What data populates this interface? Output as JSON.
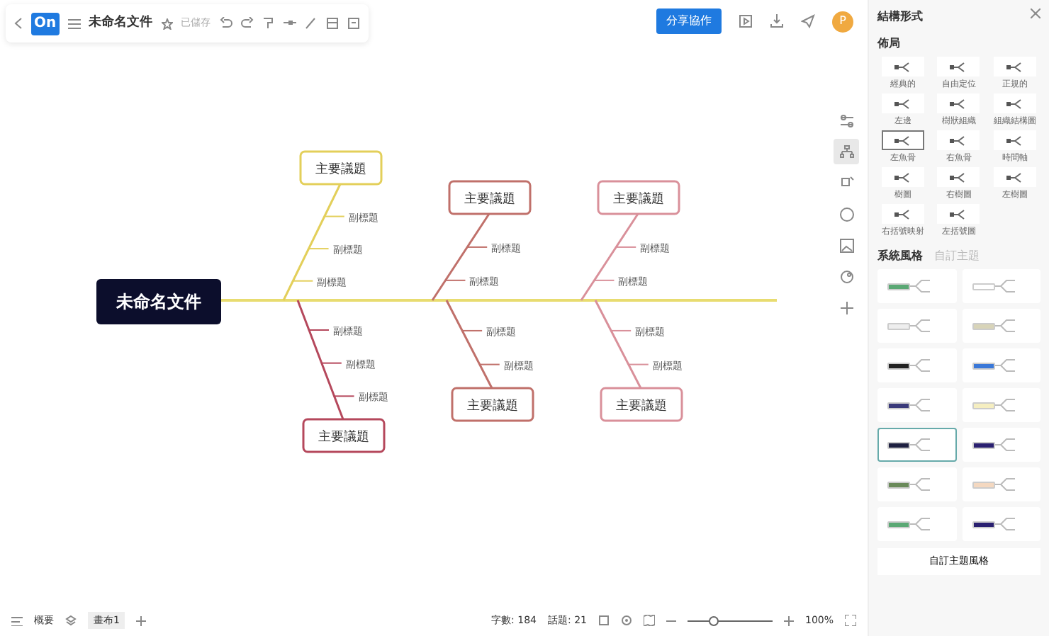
{
  "toolbar": {
    "logo": "On",
    "title": "未命名文件",
    "save_status": "已儲存",
    "share_button": "分享協作",
    "avatar": "P"
  },
  "canvas": {
    "central_topic": "未命名文件",
    "main_topics": [
      {
        "label": "主要議題",
        "kind": "top",
        "color": "#e3cf5a",
        "subtopics": [
          "副標題",
          "副標題",
          "副標題"
        ]
      },
      {
        "label": "主要議題",
        "kind": "bottom",
        "color": "#b5485c",
        "subtopics": [
          "副標題",
          "副標題",
          "副標題"
        ]
      },
      {
        "label": "主要議題",
        "kind": "top",
        "color": "#c0706a",
        "subtopics": [
          "副標題",
          "副標題"
        ]
      },
      {
        "label": "主要議題",
        "kind": "bottom",
        "color": "#c0706a",
        "subtopics": [
          "副標題",
          "副標題"
        ]
      },
      {
        "label": "主要議題",
        "kind": "top",
        "color": "#d9909a",
        "subtopics": [
          "副標題",
          "副標題"
        ]
      },
      {
        "label": "主要議題",
        "kind": "bottom",
        "color": "#d9909a",
        "subtopics": [
          "副標題",
          "副標題"
        ]
      }
    ]
  },
  "side_tools": [
    {
      "selected": false
    },
    {
      "selected": true
    },
    {
      "selected": false
    },
    {
      "selected": false
    },
    {
      "selected": false
    },
    {
      "selected": false
    },
    {
      "selected": false
    }
  ],
  "panel": {
    "title": "結構形式",
    "layout_heading": "佈局",
    "layouts": [
      {
        "label": "經典的",
        "selected": false
      },
      {
        "label": "自由定位",
        "selected": false
      },
      {
        "label": "正規的",
        "selected": false
      },
      {
        "label": "左邊",
        "selected": false
      },
      {
        "label": "樹狀組織",
        "selected": false
      },
      {
        "label": "組織結構圖",
        "selected": false
      },
      {
        "label": "左魚骨",
        "selected": true
      },
      {
        "label": "右魚骨",
        "selected": false
      },
      {
        "label": "時間軸",
        "selected": false
      },
      {
        "label": "樹圖",
        "selected": false
      },
      {
        "label": "右樹圖",
        "selected": false
      },
      {
        "label": "左樹圖",
        "selected": false
      },
      {
        "label": "右括號映射",
        "selected": false
      },
      {
        "label": "左括號圖",
        "selected": false
      }
    ],
    "tabs": [
      {
        "label": "系統風格",
        "selected": true
      },
      {
        "label": "自訂主題",
        "selected": false
      }
    ],
    "themes": [
      {
        "color": "#5aa874",
        "selected": false
      },
      {
        "color": "#ffffff",
        "selected": false
      },
      {
        "color": "#eeeeee",
        "selected": false
      },
      {
        "color": "#d8d4b8",
        "selected": false
      },
      {
        "color": "#222222",
        "selected": false
      },
      {
        "color": "#3a78d8",
        "selected": false
      },
      {
        "color": "#3a3a7a",
        "selected": false
      },
      {
        "color": "#f5eec0",
        "selected": false
      },
      {
        "color": "#1e2040",
        "selected": true
      },
      {
        "color": "#2a2070",
        "selected": false
      },
      {
        "color": "#6a8a5a",
        "selected": false
      },
      {
        "color": "#f4d8c0",
        "selected": false
      },
      {
        "color": "#5aa874",
        "selected": false
      },
      {
        "color": "#2a2070",
        "selected": false
      }
    ],
    "custom_button": "自訂主題風格"
  },
  "status_bar": {
    "outline": "概要",
    "canvas_tab": "畫布1",
    "word_count": "字數: 184",
    "topic_count": "話題: 21",
    "zoom": "100%",
    "zoom_slider": {
      "level": 0.3
    }
  }
}
